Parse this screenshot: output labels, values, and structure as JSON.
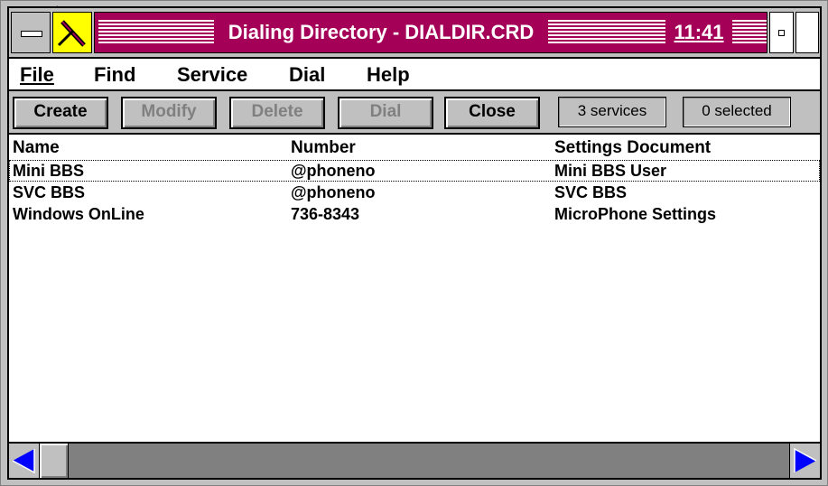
{
  "window": {
    "title": "Dialing Directory - DIALDIR.CRD",
    "clock": "11:41"
  },
  "colors": {
    "title_bar": "#a50058",
    "face": "#c0c0c0",
    "scroll_arrow": "#0000ff"
  },
  "icons": {
    "system_menu": "system-menu-icon",
    "app": "telephone-pen-icon",
    "minimize": "minimize-icon",
    "maximize": "maximize-icon",
    "scroll_left": "left-arrow-icon",
    "scroll_right": "right-arrow-icon"
  },
  "menu": {
    "file": "File",
    "find": "Find",
    "service": "Service",
    "dial": "Dial",
    "help": "Help"
  },
  "toolbar": {
    "create": "Create",
    "modify": "Modify",
    "delete": "Delete",
    "dial": "Dial",
    "close": "Close",
    "services_count": "3 services",
    "selected_count": "0 selected"
  },
  "list": {
    "columns": [
      "Name",
      "Number",
      "Settings Document"
    ],
    "rows": [
      {
        "name": "Mini BBS",
        "number": "@phoneno",
        "settings": "Mini BBS User"
      },
      {
        "name": "SVC BBS",
        "number": "@phoneno",
        "settings": "SVC BBS"
      },
      {
        "name": "Windows OnLine",
        "number": "736-8343",
        "settings": "MicroPhone Settings"
      }
    ]
  }
}
